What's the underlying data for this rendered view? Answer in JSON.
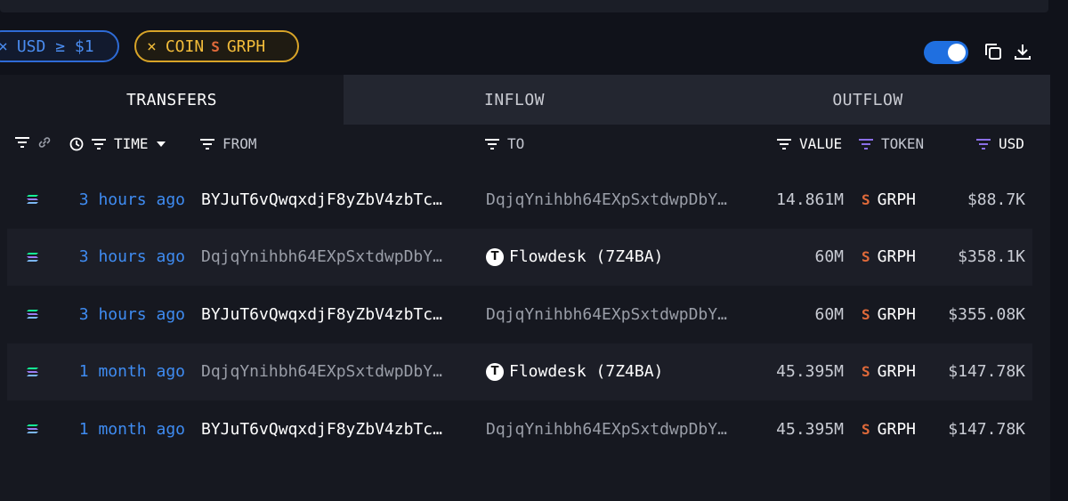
{
  "filters": {
    "usd": {
      "x": "×",
      "label": "USD ≥ $1"
    },
    "coin": {
      "x": "×",
      "prefix": "COIN",
      "token_symbol": "S",
      "token": "GRPH"
    }
  },
  "tabs": [
    "TRANSFERS",
    "INFLOW",
    "OUTFLOW"
  ],
  "columns": {
    "time": "TIME",
    "from": "FROM",
    "to": "TO",
    "value": "VALUE",
    "token": "TOKEN",
    "usd": "USD"
  },
  "rows": [
    {
      "time": "3 hours ago",
      "from": "BYJuT6vQwqxdjF8yZbV4zbTc…",
      "to": "DqjqYnihbh64EXpSxtdwpDbY…",
      "to_entity": false,
      "value": "14.861M",
      "token_symbol": "S",
      "token": "GRPH",
      "usd": "$88.7K"
    },
    {
      "time": "3 hours ago",
      "from": "DqjqYnihbh64EXpSxtdwpDbY…",
      "to": "Flowdesk (7Z4BA)",
      "to_entity": true,
      "value": "60M",
      "token_symbol": "S",
      "token": "GRPH",
      "usd": "$358.1K"
    },
    {
      "time": "3 hours ago",
      "from": "BYJuT6vQwqxdjF8yZbV4zbTc…",
      "to": "DqjqYnihbh64EXpSxtdwpDbY…",
      "to_entity": false,
      "value": "60M",
      "token_symbol": "S",
      "token": "GRPH",
      "usd": "$355.08K"
    },
    {
      "time": "1 month ago",
      "from": "DqjqYnihbh64EXpSxtdwpDbY…",
      "to": "Flowdesk (7Z4BA)",
      "to_entity": true,
      "value": "45.395M",
      "token_symbol": "S",
      "token": "GRPH",
      "usd": "$147.78K"
    },
    {
      "time": "1 month ago",
      "from": "BYJuT6vQwqxdjF8yZbV4zbTc…",
      "to": "DqjqYnihbh64EXpSxtdwpDbY…",
      "to_entity": false,
      "value": "45.395M",
      "token_symbol": "S",
      "token": "GRPH",
      "usd": "$147.78K"
    }
  ],
  "colors": {
    "accent": "#3f8cf2",
    "coin_chip": "#f2bc3a",
    "token_icon": "#e06a3a",
    "filter_icon_purple": "#8b6fe8"
  }
}
